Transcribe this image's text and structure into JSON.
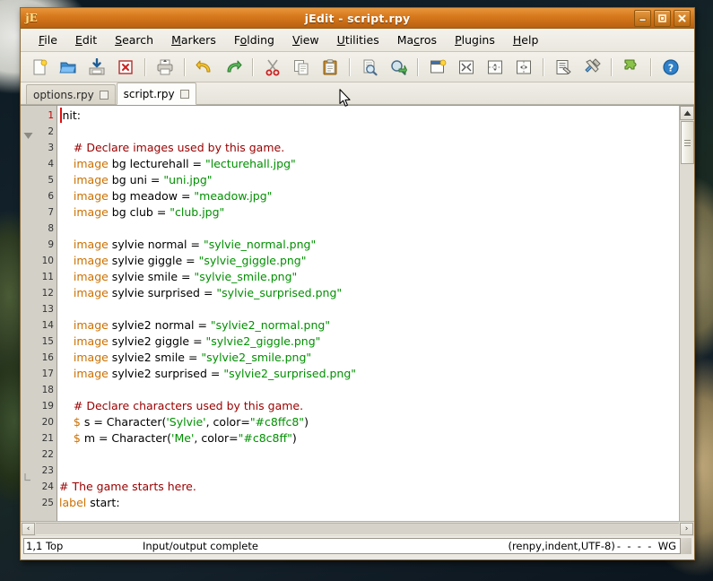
{
  "window": {
    "title": "jEdit - script.rpy",
    "app_icon": "jedit-icon",
    "buttons": {
      "minimize": "minimize-button",
      "maximize": "maximize-button",
      "close": "close-button"
    }
  },
  "menubar": {
    "items": [
      {
        "label": "File",
        "mnemonic": "F"
      },
      {
        "label": "Edit",
        "mnemonic": "E"
      },
      {
        "label": "Search",
        "mnemonic": "S"
      },
      {
        "label": "Markers",
        "mnemonic": "M"
      },
      {
        "label": "Folding",
        "mnemonic": "o"
      },
      {
        "label": "View",
        "mnemonic": "V"
      },
      {
        "label": "Utilities",
        "mnemonic": "U"
      },
      {
        "label": "Macros",
        "mnemonic": "c"
      },
      {
        "label": "Plugins",
        "mnemonic": "P"
      },
      {
        "label": "Help",
        "mnemonic": "H"
      }
    ]
  },
  "toolbar": {
    "buttons": [
      {
        "name": "new-file-icon",
        "title": "New File"
      },
      {
        "name": "open-file-icon",
        "title": "Open File"
      },
      {
        "name": "save-file-icon",
        "title": "Save"
      },
      {
        "name": "close-file-icon",
        "title": "Close"
      },
      {
        "sep": true
      },
      {
        "name": "print-icon",
        "title": "Print"
      },
      {
        "sep": true
      },
      {
        "name": "undo-icon",
        "title": "Undo"
      },
      {
        "name": "redo-icon",
        "title": "Redo"
      },
      {
        "sep": true
      },
      {
        "name": "cut-icon",
        "title": "Cut"
      },
      {
        "name": "copy-icon",
        "title": "Copy"
      },
      {
        "name": "paste-icon",
        "title": "Paste"
      },
      {
        "sep": true
      },
      {
        "name": "find-icon",
        "title": "Find"
      },
      {
        "name": "find-next-icon",
        "title": "Find Next"
      },
      {
        "sep": true
      },
      {
        "name": "new-view-icon",
        "title": "New View"
      },
      {
        "name": "unsplit-icon",
        "title": "Unsplit"
      },
      {
        "name": "split-horizontal-icon",
        "title": "Split Horizontally"
      },
      {
        "name": "split-vertical-icon",
        "title": "Split Vertically"
      },
      {
        "sep": true
      },
      {
        "name": "word-wrap-icon",
        "title": "Paragraph"
      },
      {
        "name": "global-options-icon",
        "title": "Global Options"
      },
      {
        "sep": true
      },
      {
        "name": "plugin-manager-icon",
        "title": "Plugin Manager"
      },
      {
        "sep": true
      },
      {
        "name": "help-icon",
        "title": "Help"
      }
    ]
  },
  "tabs": [
    {
      "label": "options.rpy",
      "active": false
    },
    {
      "label": "script.rpy",
      "active": true
    }
  ],
  "editor": {
    "caret_line": 1,
    "fold_open_line": 2,
    "fold_end_line": 23,
    "lines": [
      {
        "n": 1,
        "tokens": [
          {
            "t": "plain",
            "s": "init:"
          }
        ]
      },
      {
        "n": 2,
        "tokens": []
      },
      {
        "n": 3,
        "tokens": [
          {
            "t": "comment",
            "s": "    # Declare images used by this game."
          }
        ]
      },
      {
        "n": 4,
        "tokens": [
          {
            "t": "keyword",
            "s": "    image"
          },
          {
            "t": "plain",
            "s": " bg lecturehall = "
          },
          {
            "t": "string",
            "s": "\"lecturehall.jpg\""
          }
        ]
      },
      {
        "n": 5,
        "tokens": [
          {
            "t": "keyword",
            "s": "    image"
          },
          {
            "t": "plain",
            "s": " bg uni = "
          },
          {
            "t": "string",
            "s": "\"uni.jpg\""
          }
        ]
      },
      {
        "n": 6,
        "tokens": [
          {
            "t": "keyword",
            "s": "    image"
          },
          {
            "t": "plain",
            "s": " bg meadow = "
          },
          {
            "t": "string",
            "s": "\"meadow.jpg\""
          }
        ]
      },
      {
        "n": 7,
        "tokens": [
          {
            "t": "keyword",
            "s": "    image"
          },
          {
            "t": "plain",
            "s": " bg club = "
          },
          {
            "t": "string",
            "s": "\"club.jpg\""
          }
        ]
      },
      {
        "n": 8,
        "tokens": []
      },
      {
        "n": 9,
        "tokens": [
          {
            "t": "keyword",
            "s": "    image"
          },
          {
            "t": "plain",
            "s": " sylvie normal = "
          },
          {
            "t": "string",
            "s": "\"sylvie_normal.png\""
          }
        ]
      },
      {
        "n": 10,
        "tokens": [
          {
            "t": "keyword",
            "s": "    image"
          },
          {
            "t": "plain",
            "s": " sylvie giggle = "
          },
          {
            "t": "string",
            "s": "\"sylvie_giggle.png\""
          }
        ]
      },
      {
        "n": 11,
        "tokens": [
          {
            "t": "keyword",
            "s": "    image"
          },
          {
            "t": "plain",
            "s": " sylvie smile = "
          },
          {
            "t": "string",
            "s": "\"sylvie_smile.png\""
          }
        ]
      },
      {
        "n": 12,
        "tokens": [
          {
            "t": "keyword",
            "s": "    image"
          },
          {
            "t": "plain",
            "s": " sylvie surprised = "
          },
          {
            "t": "string",
            "s": "\"sylvie_surprised.png\""
          }
        ]
      },
      {
        "n": 13,
        "tokens": []
      },
      {
        "n": 14,
        "tokens": [
          {
            "t": "keyword",
            "s": "    image"
          },
          {
            "t": "plain",
            "s": " sylvie2 normal = "
          },
          {
            "t": "string",
            "s": "\"sylvie2_normal.png\""
          }
        ]
      },
      {
        "n": 15,
        "tokens": [
          {
            "t": "keyword",
            "s": "    image"
          },
          {
            "t": "plain",
            "s": " sylvie2 giggle = "
          },
          {
            "t": "string",
            "s": "\"sylvie2_giggle.png\""
          }
        ]
      },
      {
        "n": 16,
        "tokens": [
          {
            "t": "keyword",
            "s": "    image"
          },
          {
            "t": "plain",
            "s": " sylvie2 smile = "
          },
          {
            "t": "string",
            "s": "\"sylvie2_smile.png\""
          }
        ]
      },
      {
        "n": 17,
        "tokens": [
          {
            "t": "keyword",
            "s": "    image"
          },
          {
            "t": "plain",
            "s": " sylvie2 surprised = "
          },
          {
            "t": "string",
            "s": "\"sylvie2_surprised.png\""
          }
        ]
      },
      {
        "n": 18,
        "tokens": []
      },
      {
        "n": 19,
        "tokens": [
          {
            "t": "comment",
            "s": "    # Declare characters used by this game."
          }
        ]
      },
      {
        "n": 20,
        "tokens": [
          {
            "t": "keyword",
            "s": "    $"
          },
          {
            "t": "plain",
            "s": " s = Character("
          },
          {
            "t": "string",
            "s": "'Sylvie'"
          },
          {
            "t": "plain",
            "s": ", color="
          },
          {
            "t": "string",
            "s": "\"#c8ffc8\""
          },
          {
            "t": "plain",
            "s": ")"
          }
        ]
      },
      {
        "n": 21,
        "tokens": [
          {
            "t": "keyword",
            "s": "    $"
          },
          {
            "t": "plain",
            "s": " m = Character("
          },
          {
            "t": "string",
            "s": "'Me'"
          },
          {
            "t": "plain",
            "s": ", color="
          },
          {
            "t": "string",
            "s": "\"#c8c8ff\""
          },
          {
            "t": "plain",
            "s": ")"
          }
        ]
      },
      {
        "n": 22,
        "tokens": []
      },
      {
        "n": 23,
        "tokens": []
      },
      {
        "n": 24,
        "tokens": [
          {
            "t": "comment",
            "s": "# The game starts here."
          }
        ]
      },
      {
        "n": 25,
        "tokens": [
          {
            "t": "keyword",
            "s": "label"
          },
          {
            "t": "plain",
            "s": " start:"
          }
        ]
      }
    ]
  },
  "scrollbars": {
    "vertical": {
      "up_arrow": "scroll-up-arrow-icon",
      "thumb": "vertical-scroll-thumb"
    },
    "horizontal": {
      "left_arrow": "‹",
      "right_arrow": "›"
    }
  },
  "statusbar": {
    "caret": "1,1 Top",
    "message": "Input/output complete",
    "mode": "(renpy,indent,UTF-8)",
    "flags": "-  -  -  -  WG"
  },
  "colors": {
    "titlebar": "#d87a1e",
    "comment": "#990000",
    "keyword": "#cc7000",
    "string": "#009000",
    "caret": "#e01010",
    "current_line_number": "#cc0000",
    "gutter_bg": "#d3d0c8",
    "editor_bg": "#ffffff"
  }
}
